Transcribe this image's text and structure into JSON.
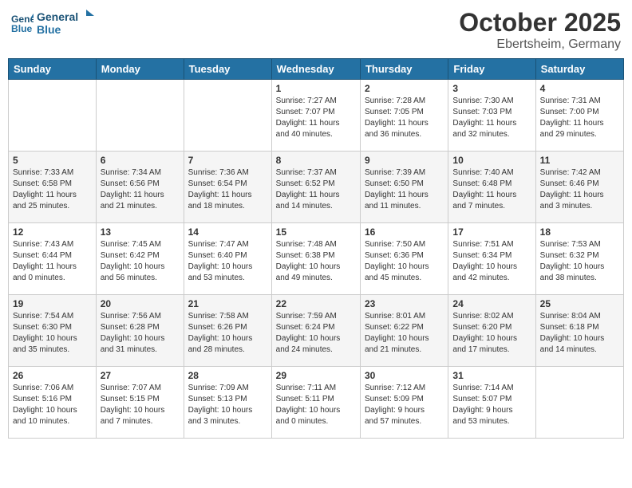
{
  "header": {
    "logo_line1": "General",
    "logo_line2": "Blue",
    "month": "October 2025",
    "location": "Ebertsheim, Germany"
  },
  "weekdays": [
    "Sunday",
    "Monday",
    "Tuesday",
    "Wednesday",
    "Thursday",
    "Friday",
    "Saturday"
  ],
  "weeks": [
    [
      {
        "day": "",
        "info": ""
      },
      {
        "day": "",
        "info": ""
      },
      {
        "day": "",
        "info": ""
      },
      {
        "day": "1",
        "info": "Sunrise: 7:27 AM\nSunset: 7:07 PM\nDaylight: 11 hours\nand 40 minutes."
      },
      {
        "day": "2",
        "info": "Sunrise: 7:28 AM\nSunset: 7:05 PM\nDaylight: 11 hours\nand 36 minutes."
      },
      {
        "day": "3",
        "info": "Sunrise: 7:30 AM\nSunset: 7:03 PM\nDaylight: 11 hours\nand 32 minutes."
      },
      {
        "day": "4",
        "info": "Sunrise: 7:31 AM\nSunset: 7:00 PM\nDaylight: 11 hours\nand 29 minutes."
      }
    ],
    [
      {
        "day": "5",
        "info": "Sunrise: 7:33 AM\nSunset: 6:58 PM\nDaylight: 11 hours\nand 25 minutes."
      },
      {
        "day": "6",
        "info": "Sunrise: 7:34 AM\nSunset: 6:56 PM\nDaylight: 11 hours\nand 21 minutes."
      },
      {
        "day": "7",
        "info": "Sunrise: 7:36 AM\nSunset: 6:54 PM\nDaylight: 11 hours\nand 18 minutes."
      },
      {
        "day": "8",
        "info": "Sunrise: 7:37 AM\nSunset: 6:52 PM\nDaylight: 11 hours\nand 14 minutes."
      },
      {
        "day": "9",
        "info": "Sunrise: 7:39 AM\nSunset: 6:50 PM\nDaylight: 11 hours\nand 11 minutes."
      },
      {
        "day": "10",
        "info": "Sunrise: 7:40 AM\nSunset: 6:48 PM\nDaylight: 11 hours\nand 7 minutes."
      },
      {
        "day": "11",
        "info": "Sunrise: 7:42 AM\nSunset: 6:46 PM\nDaylight: 11 hours\nand 3 minutes."
      }
    ],
    [
      {
        "day": "12",
        "info": "Sunrise: 7:43 AM\nSunset: 6:44 PM\nDaylight: 11 hours\nand 0 minutes."
      },
      {
        "day": "13",
        "info": "Sunrise: 7:45 AM\nSunset: 6:42 PM\nDaylight: 10 hours\nand 56 minutes."
      },
      {
        "day": "14",
        "info": "Sunrise: 7:47 AM\nSunset: 6:40 PM\nDaylight: 10 hours\nand 53 minutes."
      },
      {
        "day": "15",
        "info": "Sunrise: 7:48 AM\nSunset: 6:38 PM\nDaylight: 10 hours\nand 49 minutes."
      },
      {
        "day": "16",
        "info": "Sunrise: 7:50 AM\nSunset: 6:36 PM\nDaylight: 10 hours\nand 45 minutes."
      },
      {
        "day": "17",
        "info": "Sunrise: 7:51 AM\nSunset: 6:34 PM\nDaylight: 10 hours\nand 42 minutes."
      },
      {
        "day": "18",
        "info": "Sunrise: 7:53 AM\nSunset: 6:32 PM\nDaylight: 10 hours\nand 38 minutes."
      }
    ],
    [
      {
        "day": "19",
        "info": "Sunrise: 7:54 AM\nSunset: 6:30 PM\nDaylight: 10 hours\nand 35 minutes."
      },
      {
        "day": "20",
        "info": "Sunrise: 7:56 AM\nSunset: 6:28 PM\nDaylight: 10 hours\nand 31 minutes."
      },
      {
        "day": "21",
        "info": "Sunrise: 7:58 AM\nSunset: 6:26 PM\nDaylight: 10 hours\nand 28 minutes."
      },
      {
        "day": "22",
        "info": "Sunrise: 7:59 AM\nSunset: 6:24 PM\nDaylight: 10 hours\nand 24 minutes."
      },
      {
        "day": "23",
        "info": "Sunrise: 8:01 AM\nSunset: 6:22 PM\nDaylight: 10 hours\nand 21 minutes."
      },
      {
        "day": "24",
        "info": "Sunrise: 8:02 AM\nSunset: 6:20 PM\nDaylight: 10 hours\nand 17 minutes."
      },
      {
        "day": "25",
        "info": "Sunrise: 8:04 AM\nSunset: 6:18 PM\nDaylight: 10 hours\nand 14 minutes."
      }
    ],
    [
      {
        "day": "26",
        "info": "Sunrise: 7:06 AM\nSunset: 5:16 PM\nDaylight: 10 hours\nand 10 minutes."
      },
      {
        "day": "27",
        "info": "Sunrise: 7:07 AM\nSunset: 5:15 PM\nDaylight: 10 hours\nand 7 minutes."
      },
      {
        "day": "28",
        "info": "Sunrise: 7:09 AM\nSunset: 5:13 PM\nDaylight: 10 hours\nand 3 minutes."
      },
      {
        "day": "29",
        "info": "Sunrise: 7:11 AM\nSunset: 5:11 PM\nDaylight: 10 hours\nand 0 minutes."
      },
      {
        "day": "30",
        "info": "Sunrise: 7:12 AM\nSunset: 5:09 PM\nDaylight: 9 hours\nand 57 minutes."
      },
      {
        "day": "31",
        "info": "Sunrise: 7:14 AM\nSunset: 5:07 PM\nDaylight: 9 hours\nand 53 minutes."
      },
      {
        "day": "",
        "info": ""
      }
    ]
  ]
}
